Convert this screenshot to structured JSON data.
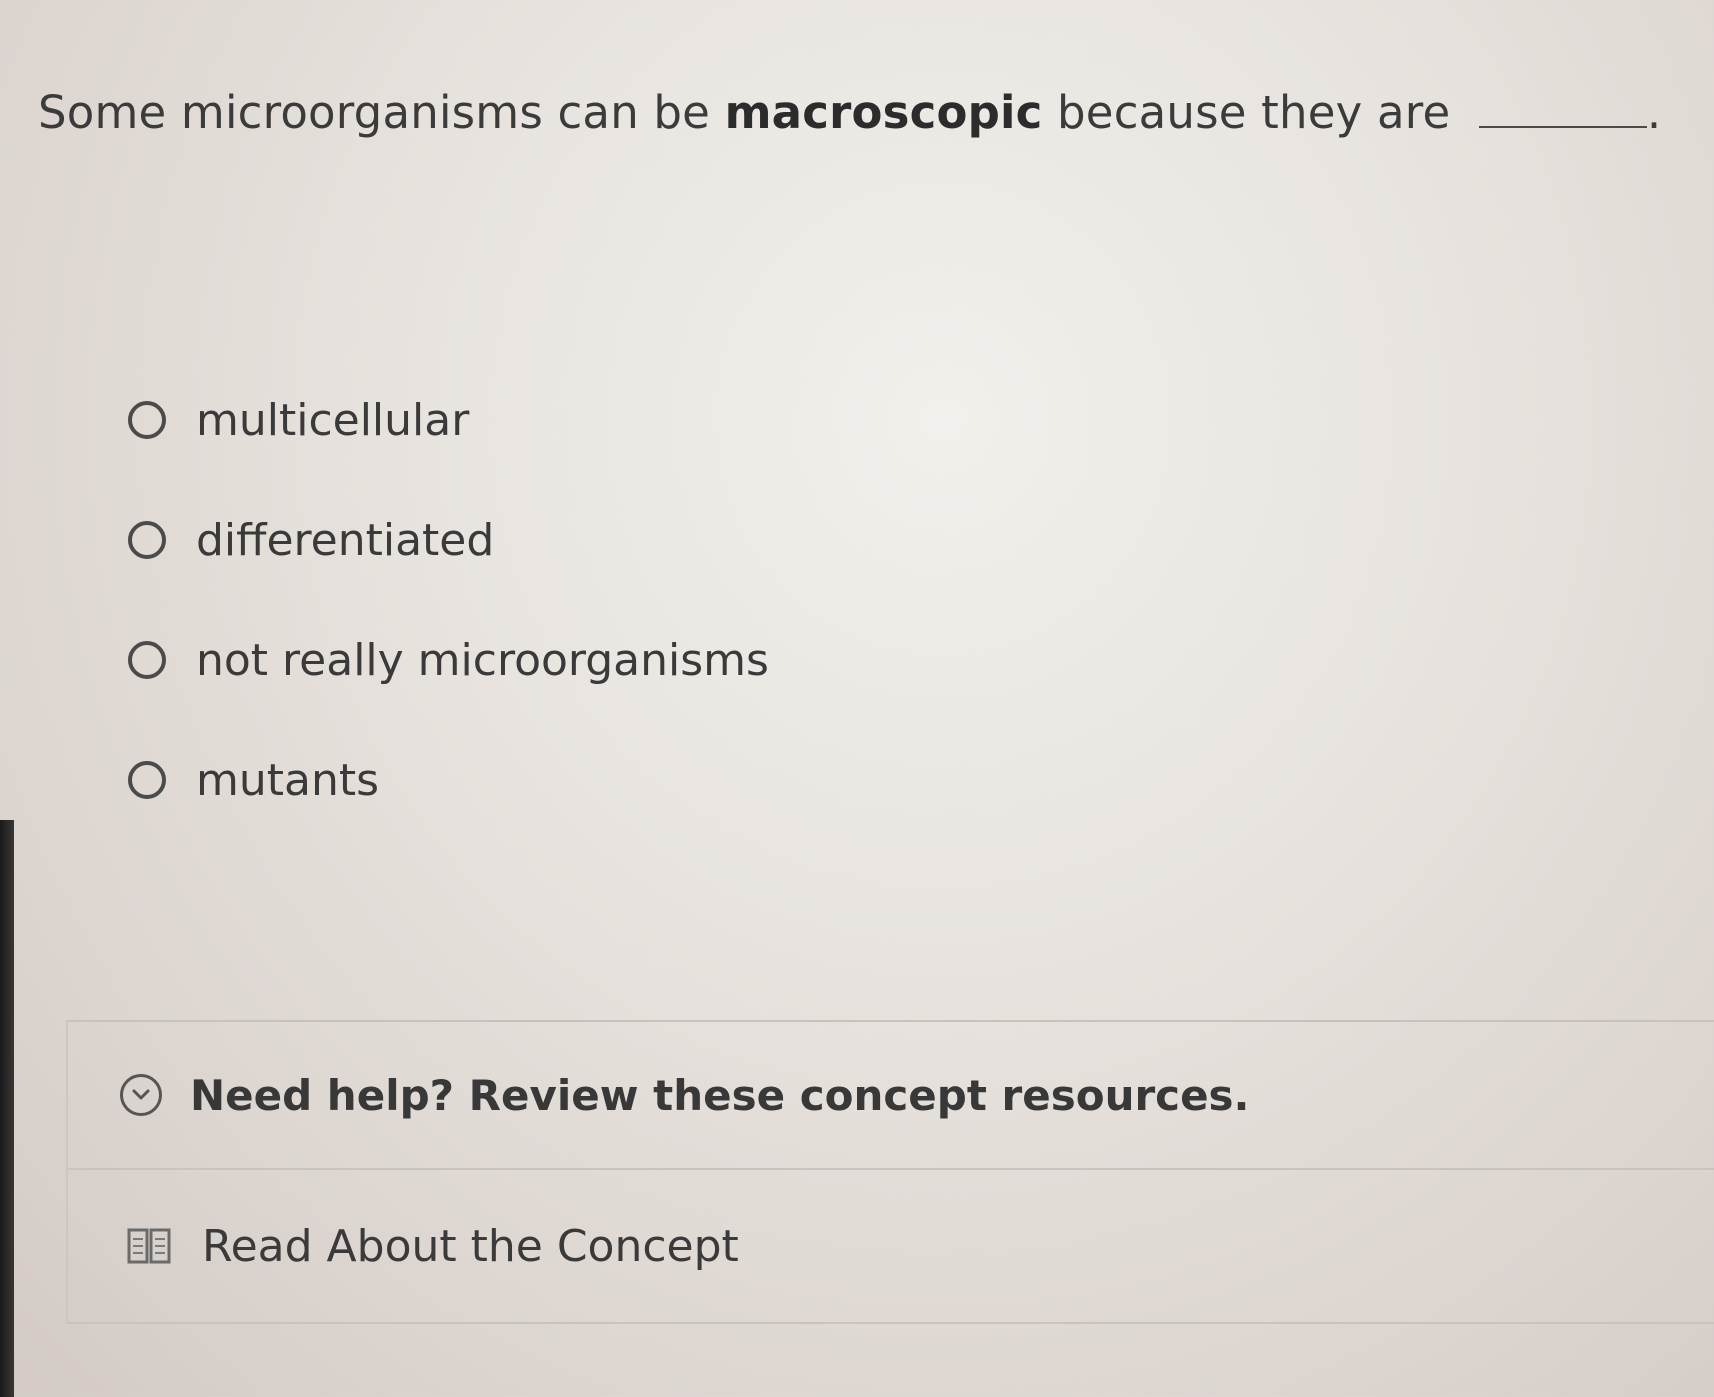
{
  "question": {
    "prefix": "Some microorganisms can be",
    "bold_term": "macroscopic",
    "suffix": "because they are",
    "end": "."
  },
  "options": [
    {
      "label": "multicellular"
    },
    {
      "label": "differentiated"
    },
    {
      "label": "not really microorganisms"
    },
    {
      "label": "mutants"
    }
  ],
  "help": {
    "title": "Need help? Review these concept resources.",
    "icon": "chevron-down-icon",
    "resources": [
      {
        "label": "Read About the Concept",
        "icon": "book-icon"
      }
    ]
  }
}
